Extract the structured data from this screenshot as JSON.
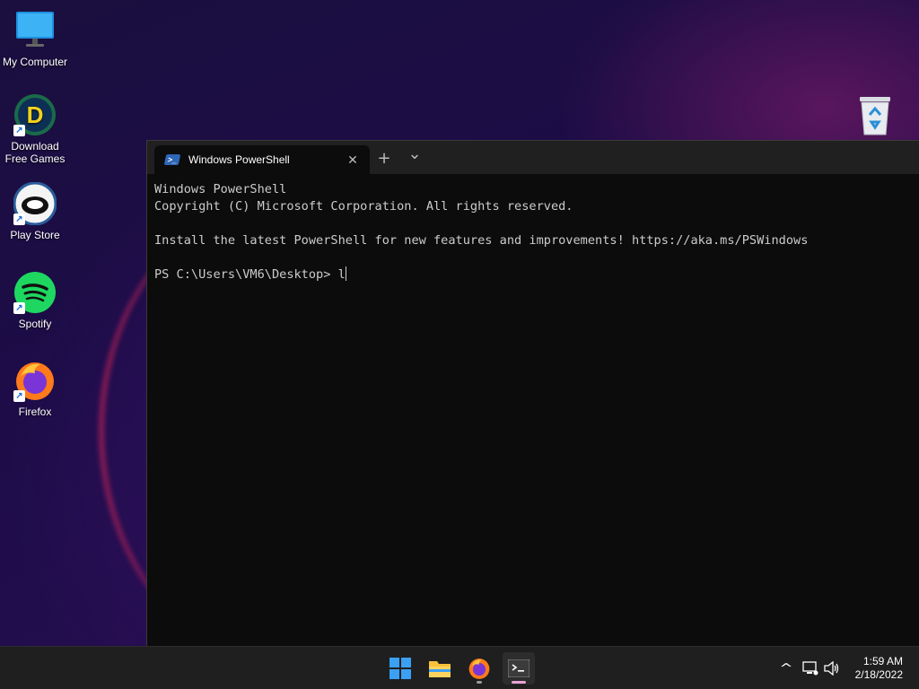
{
  "desktop": {
    "icons": [
      {
        "label": "My Computer"
      },
      {
        "label": "Download\nFree Games"
      },
      {
        "label": "Play Store"
      },
      {
        "label": "Spotify"
      },
      {
        "label": "Firefox"
      }
    ]
  },
  "terminal": {
    "tab_title": "Windows PowerShell",
    "tab_close": "✕",
    "new_tab": "+",
    "dropdown": "⌄",
    "lines": [
      "Windows PowerShell",
      "Copyright (C) Microsoft Corporation. All rights reserved.",
      "",
      "Install the latest PowerShell for new features and improvements! https://aka.ms/PSWindows",
      ""
    ],
    "prompt": "PS C:\\Users\\VM6\\Desktop> ",
    "input": "l"
  },
  "taskbar": {
    "clock_time": "1:59 AM",
    "clock_date": "2/18/2022",
    "chevron": "^"
  },
  "colors": {
    "terminal_bg": "#0c0c0c",
    "tabbar_bg": "#202020",
    "taskbar_bg": "#1f1f1f",
    "accent": "#0078d4"
  }
}
